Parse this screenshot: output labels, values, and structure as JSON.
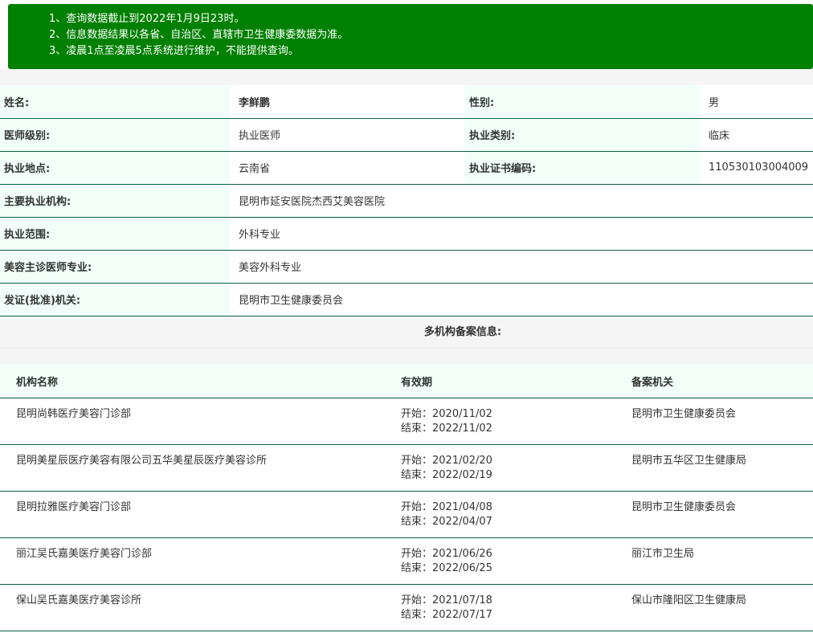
{
  "notice": {
    "lines": [
      "1、查询数据截止到2022年1月9日23时。",
      "2、信息数据结果以各省、自治区、直辖市卫生健康委数据为准。",
      "3、凌晨1点至凌晨5点系统进行维护，不能提供查询。"
    ]
  },
  "doctor": {
    "name_label": "姓名:",
    "name": "李鲜鹏",
    "gender_label": "性别:",
    "gender": "男",
    "level_label": "医师级别:",
    "level": "执业医师",
    "category_label": "执业类别:",
    "category": "临床",
    "location_label": "执业地点:",
    "location": "云南省",
    "cert_label": "执业证书编码:",
    "cert": "110530103004009",
    "institution_label": "主要执业机构:",
    "institution": "昆明市延安医院杰西艾美容医院",
    "scope_label": "执业范围:",
    "scope": "外科专业",
    "cosmetic_label": "美容主诊医师专业:",
    "cosmetic": "美容外科专业",
    "authority_label": "发证(批准)机关:",
    "authority": "昆明市卫生健康委员会"
  },
  "multi": {
    "title": "多机构备案信息:",
    "headers": {
      "name": "机构名称",
      "period": "有效期",
      "org": "备案机关"
    },
    "rows": [
      {
        "name": "昆明尚韩医疗美容门诊部",
        "start": "开始：2020/11/02",
        "end": "结束：2022/11/02",
        "org": "昆明市卫生健康委员会"
      },
      {
        "name": "昆明美星辰医疗美容有限公司五华美星辰医疗美容诊所",
        "start": "开始：2021/02/20",
        "end": "结束：2022/02/19",
        "org": "昆明市五华区卫生健康局"
      },
      {
        "name": "昆明拉雅医疗美容门诊部",
        "start": "开始：2021/04/08",
        "end": "结束：2022/04/07",
        "org": "昆明市卫生健康委员会"
      },
      {
        "name": "丽江吴氏嘉美医疗美容门诊部",
        "start": "开始：2021/06/26",
        "end": "结束：2022/06/25",
        "org": "丽江市卫生局"
      },
      {
        "name": "保山吴氏嘉美医疗美容诊所",
        "start": "开始：2021/07/18",
        "end": "结束：2022/07/17",
        "org": "保山市隆阳区卫生健康局"
      }
    ]
  },
  "colors": {
    "notice_bg": "#008000",
    "label_bg": "#f1fff8",
    "divider": "#0f5f4a"
  }
}
